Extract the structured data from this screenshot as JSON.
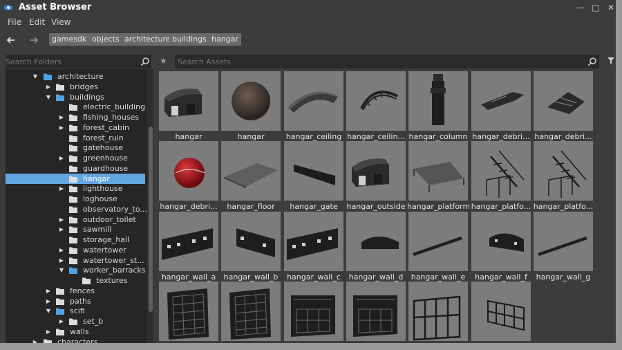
{
  "window": {
    "title": "Asset Browser"
  },
  "menu": [
    "File",
    "Edit",
    "View"
  ],
  "breadcrumbs": [
    "gamesdk",
    "objects",
    "architecture",
    "buildings",
    "hangar"
  ],
  "folder_search": {
    "placeholder": "Search Folders"
  },
  "asset_search": {
    "placeholder": "Search Assets"
  },
  "tree": [
    {
      "label": "architecture",
      "depth": 0,
      "arrow": "down",
      "icon": "folder-open",
      "selected": false
    },
    {
      "label": "bridges",
      "depth": 1,
      "arrow": "right",
      "icon": "folder",
      "selected": false
    },
    {
      "label": "buildings",
      "depth": 1,
      "arrow": "down",
      "icon": "folder-open",
      "selected": false
    },
    {
      "label": "electric_building",
      "depth": 2,
      "arrow": "",
      "icon": "folder",
      "selected": false
    },
    {
      "label": "fishing_houses",
      "depth": 2,
      "arrow": "right",
      "icon": "folder",
      "selected": false
    },
    {
      "label": "forest_cabin",
      "depth": 2,
      "arrow": "right",
      "icon": "folder",
      "selected": false
    },
    {
      "label": "forest_ruin",
      "depth": 2,
      "arrow": "",
      "icon": "folder",
      "selected": false
    },
    {
      "label": "gatehouse",
      "depth": 2,
      "arrow": "",
      "icon": "folder",
      "selected": false
    },
    {
      "label": "greenhouse",
      "depth": 2,
      "arrow": "right",
      "icon": "folder",
      "selected": false
    },
    {
      "label": "guardhouse",
      "depth": 2,
      "arrow": "",
      "icon": "folder",
      "selected": false
    },
    {
      "label": "hangar",
      "depth": 2,
      "arrow": "",
      "icon": "folder",
      "selected": true
    },
    {
      "label": "lighthouse",
      "depth": 2,
      "arrow": "right",
      "icon": "folder",
      "selected": false
    },
    {
      "label": "loghouse",
      "depth": 2,
      "arrow": "",
      "icon": "folder",
      "selected": false
    },
    {
      "label": "observatory_to...",
      "depth": 2,
      "arrow": "",
      "icon": "folder",
      "selected": false
    },
    {
      "label": "outdoor_toilet",
      "depth": 2,
      "arrow": "right",
      "icon": "folder",
      "selected": false
    },
    {
      "label": "sawmill",
      "depth": 2,
      "arrow": "right",
      "icon": "folder",
      "selected": false
    },
    {
      "label": "storage_hall",
      "depth": 2,
      "arrow": "",
      "icon": "folder",
      "selected": false
    },
    {
      "label": "watertower",
      "depth": 2,
      "arrow": "right",
      "icon": "folder",
      "selected": false
    },
    {
      "label": "watertower_st...",
      "depth": 2,
      "arrow": "right",
      "icon": "folder",
      "selected": false
    },
    {
      "label": "worker_barracks",
      "depth": 2,
      "arrow": "down",
      "icon": "folder-open",
      "selected": false
    },
    {
      "label": "textures",
      "depth": 3,
      "arrow": "",
      "icon": "folder",
      "selected": false
    },
    {
      "label": "fences",
      "depth": 1,
      "arrow": "right",
      "icon": "folder",
      "selected": false
    },
    {
      "label": "paths",
      "depth": 1,
      "arrow": "right",
      "icon": "folder",
      "selected": false
    },
    {
      "label": "scifi",
      "depth": 1,
      "arrow": "down",
      "icon": "folder-open",
      "selected": false
    },
    {
      "label": "set_b",
      "depth": 2,
      "arrow": "right",
      "icon": "folder",
      "selected": false
    },
    {
      "label": "walls",
      "depth": 1,
      "arrow": "right",
      "icon": "folder",
      "selected": false
    },
    {
      "label": "characters",
      "depth": 0,
      "arrow": "right",
      "icon": "folder",
      "selected": false
    }
  ],
  "assets": [
    {
      "label": "hangar",
      "thumb": "hangar-building"
    },
    {
      "label": "hangar",
      "thumb": "sphere"
    },
    {
      "label": "hangar_ceiling",
      "thumb": "ceiling"
    },
    {
      "label": "hangar_ceilin...",
      "thumb": "arch"
    },
    {
      "label": "hangar_column",
      "thumb": "column"
    },
    {
      "label": "hangar_debri...",
      "thumb": "debris"
    },
    {
      "label": "hangar_debri...",
      "thumb": "debris2"
    },
    {
      "label": "hangar_debri...",
      "thumb": "red-sphere"
    },
    {
      "label": "hangar_floor",
      "thumb": "floor"
    },
    {
      "label": "hangar_gate",
      "thumb": "gate"
    },
    {
      "label": "hangar_outside",
      "thumb": "hangar-building"
    },
    {
      "label": "hangar_platform",
      "thumb": "platform"
    },
    {
      "label": "hangar_platfo...",
      "thumb": "stairs"
    },
    {
      "label": "hangar_platfo...",
      "thumb": "stairs"
    },
    {
      "label": "hangar_wall_a",
      "thumb": "wall-windows"
    },
    {
      "label": "hangar_wall_b",
      "thumb": "wall-windows2"
    },
    {
      "label": "hangar_wall_c",
      "thumb": "wall-windows"
    },
    {
      "label": "hangar_wall_d",
      "thumb": "wall-arch"
    },
    {
      "label": "hangar_wall_e",
      "thumb": "beam"
    },
    {
      "label": "hangar_wall_f",
      "thumb": "wall-arch-windows"
    },
    {
      "label": "hangar_wall_g",
      "thumb": "beam"
    },
    {
      "label": "",
      "thumb": "window-panel"
    },
    {
      "label": "",
      "thumb": "window-panel"
    },
    {
      "label": "",
      "thumb": "window-panel2"
    },
    {
      "label": "",
      "thumb": "window-panel2"
    },
    {
      "label": "",
      "thumb": "window-frame"
    },
    {
      "label": "",
      "thumb": "window-frame2"
    }
  ],
  "colors": {
    "accent": "#63a7e0",
    "folder": "#dcdcdc",
    "folder_open": "#4fa3e3",
    "tile_bg": "#7c7c7c"
  }
}
